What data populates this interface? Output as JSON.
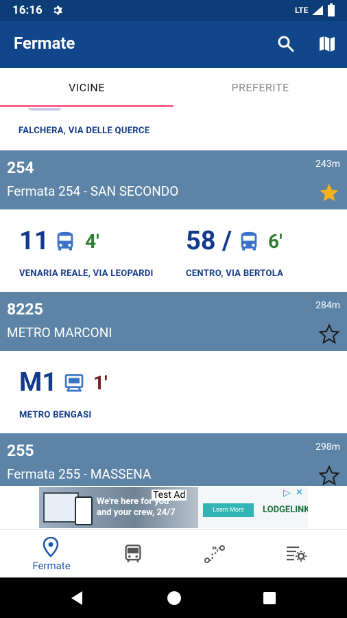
{
  "status_bar": {
    "time": "16:16",
    "network": "LTE"
  },
  "app_bar": {
    "title": "Fermate",
    "search_icon": "search-icon",
    "map_icon": "map-icon"
  },
  "tabs": {
    "active": "VICINE",
    "inactive": "PREFERITE",
    "indicator_color": "#ff5f8a"
  },
  "partial_stop": {
    "destination": "FALCHERA, VIA DELLE QUERCE"
  },
  "stops": [
    {
      "code": "254",
      "name": "Fermata 254 - SAN SECONDO",
      "distance": "243m",
      "favorite": true,
      "lines": [
        {
          "line": "11",
          "separator": "",
          "eta": "4'",
          "destination": "VENARIA REALE, VIA LEOPARDI",
          "icon": "bus-icon",
          "eta_color": "#2e7d32"
        },
        {
          "line": "58",
          "separator": "/",
          "eta": "6'",
          "destination": "CENTRO, VIA BERTOLA",
          "icon": "bus-icon",
          "eta_color": "#2e7d32"
        }
      ]
    },
    {
      "code": "8225",
      "name": "METRO MARCONI",
      "distance": "284m",
      "favorite": false,
      "lines": [
        {
          "line": "M1",
          "separator": "",
          "eta": "1'",
          "destination": "METRO BENGASI",
          "icon": "metro-icon",
          "eta_color": "#7a1f1f"
        }
      ]
    },
    {
      "code": "255",
      "name": "Fermata 255 - MASSENA",
      "distance": "298m",
      "favorite": false,
      "lines": []
    }
  ],
  "ad": {
    "label": "Test Ad",
    "text_line1": "We're here for you",
    "text_line2": "and your crew, 24/7",
    "button": "Learn More",
    "brand": "LODGELINK"
  },
  "bottom_nav": [
    {
      "label": "Fermate",
      "icon": "location-pin-icon",
      "active": true
    },
    {
      "label": "",
      "icon": "bus-icon",
      "active": false
    },
    {
      "label": "",
      "icon": "route-icon",
      "active": false
    },
    {
      "label": "",
      "icon": "settings-list-icon",
      "active": false
    }
  ],
  "colors": {
    "status_bar": "#0d3d77",
    "app_bar": "#11478a",
    "stop_header": "#5d84a7",
    "line_blue": "#123a8c",
    "star_gold": "#f3b21c"
  }
}
